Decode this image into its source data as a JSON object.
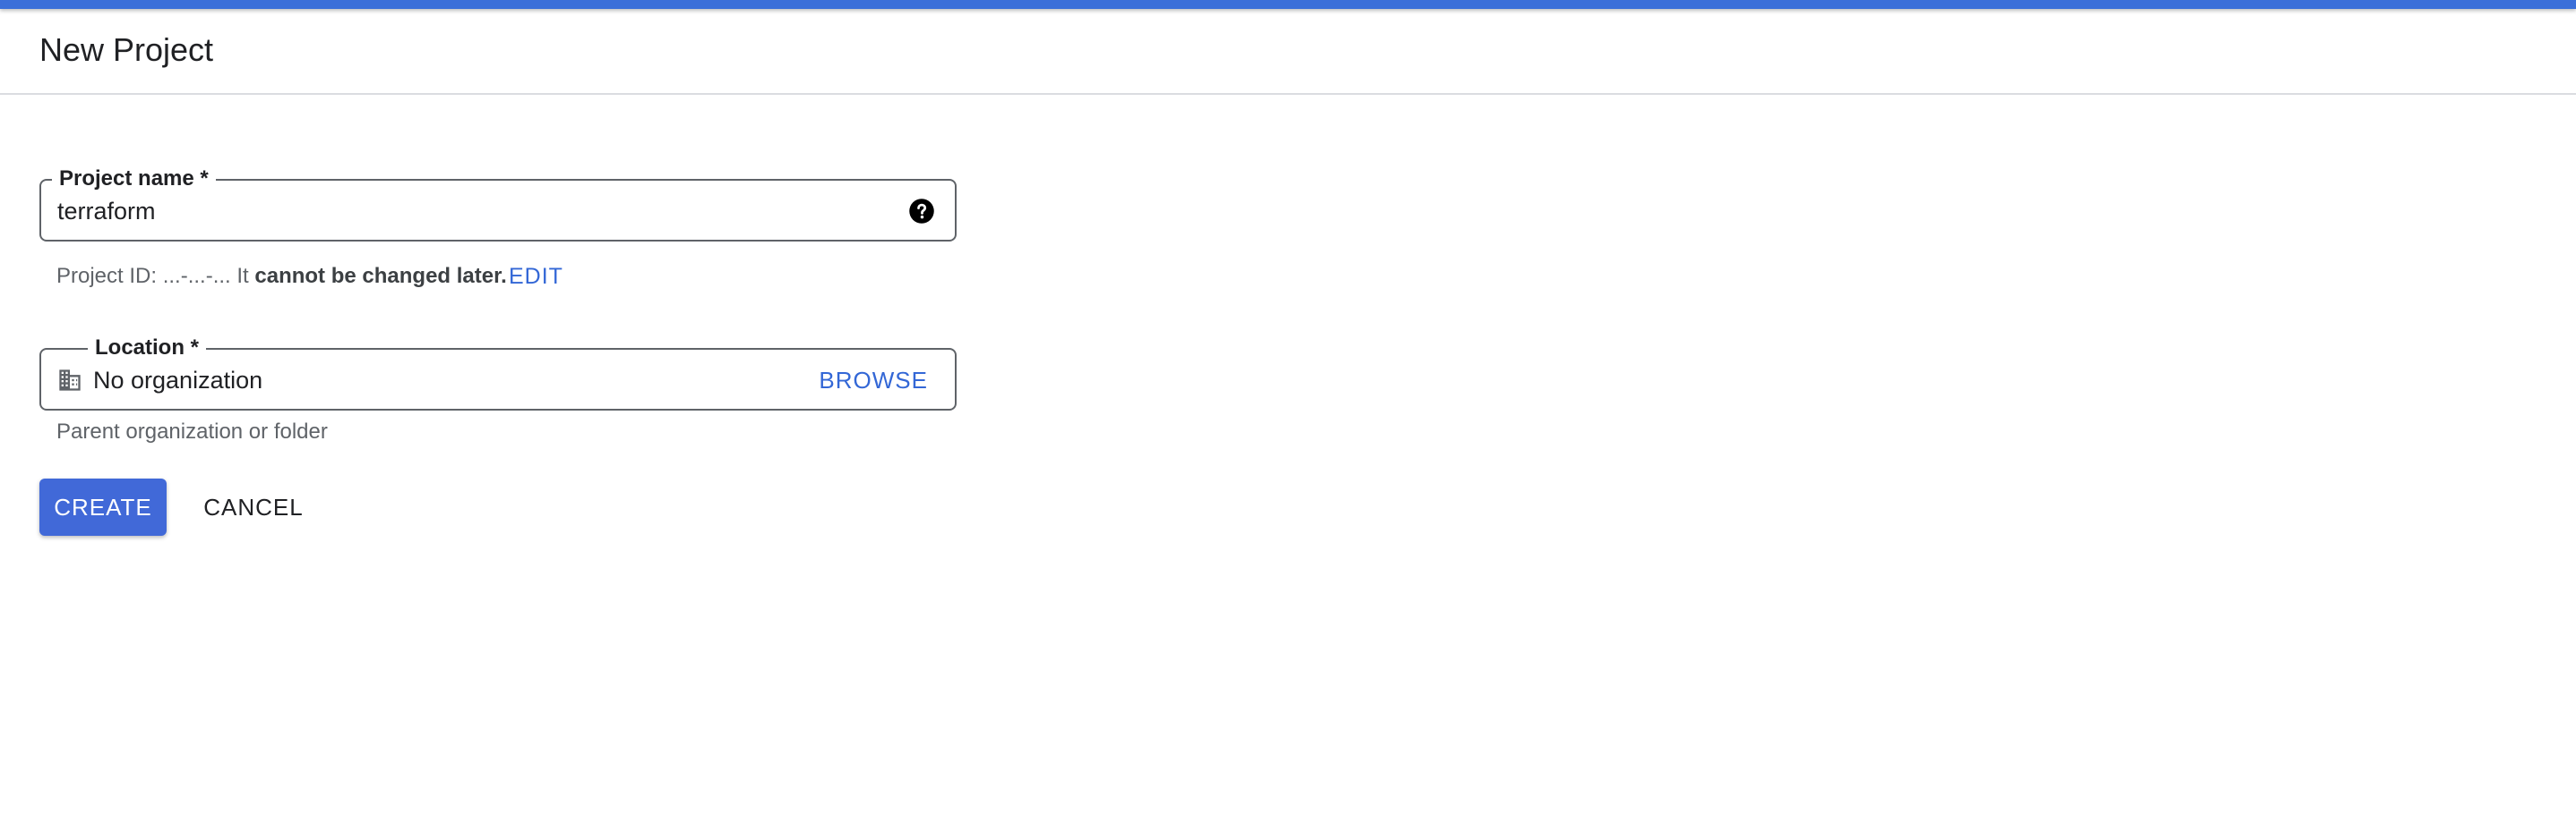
{
  "header": {
    "title": "New Project"
  },
  "colors": {
    "accent": "#3b6fd9",
    "link": "#3367d6",
    "primary_button": "#4169d8"
  },
  "project_name": {
    "label": "Project name *",
    "value": "terraform",
    "help_icon": "help-circle-icon"
  },
  "project_id": {
    "prefix": "Project ID: ...-...-... It ",
    "emphasis": "cannot be changed later.",
    "edit_label": "EDIT"
  },
  "location": {
    "label": "Location *",
    "value": "No organization",
    "icon": "building-icon",
    "browse_label": "BROWSE",
    "hint": "Parent organization or folder"
  },
  "actions": {
    "create_label": "CREATE",
    "cancel_label": "CANCEL"
  }
}
